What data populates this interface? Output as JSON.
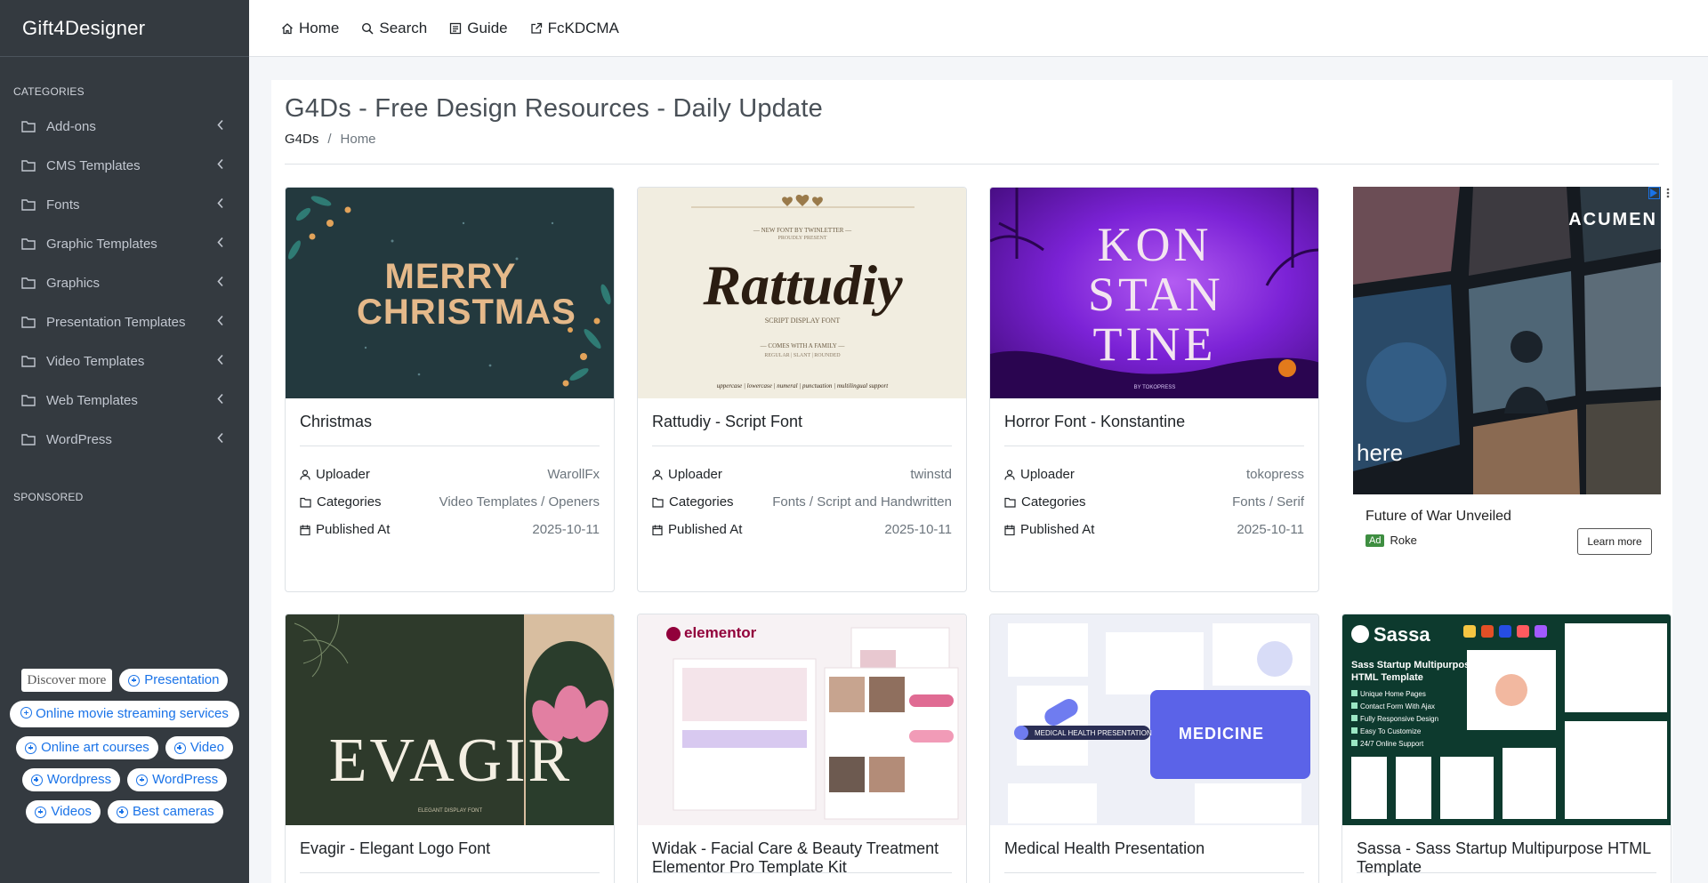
{
  "sidebar": {
    "brand": "Gift4Designer",
    "categories_header": "CATEGORIES",
    "items": [
      {
        "label": "Add-ons"
      },
      {
        "label": "CMS Templates"
      },
      {
        "label": "Fonts"
      },
      {
        "label": "Graphic Templates"
      },
      {
        "label": "Graphics"
      },
      {
        "label": "Presentation Templates"
      },
      {
        "label": "Video Templates"
      },
      {
        "label": "Web Templates"
      },
      {
        "label": "WordPress"
      }
    ],
    "sponsored_header": "SPONSORED",
    "chips": {
      "discover": "Discover more",
      "presentation": "Presentation",
      "streaming": "Online movie streaming services",
      "art": "Online art courses",
      "video": "Video",
      "wordpress1": "Wordpress",
      "wordpress2": "WordPress",
      "videos": "Videos",
      "cameras": "Best cameras"
    }
  },
  "topnav": {
    "home": "Home",
    "search": "Search",
    "guide": "Guide",
    "fckdcma": "FcKDCMA"
  },
  "page": {
    "title": "G4Ds - Free Design Resources - Daily Update",
    "breadcrumb": {
      "root": "G4Ds",
      "current": "Home"
    }
  },
  "meta_labels": {
    "uploader": "Uploader",
    "categories": "Categories",
    "published": "Published At"
  },
  "cards": [
    {
      "title": "Christmas",
      "uploader": "WarollFx",
      "categories": "Video Templates / Openers",
      "published": "2025-10-11",
      "thumb_text": "MERRY CHRISTMAS"
    },
    {
      "title": "Rattudiy - Script Font",
      "uploader": "twinstd",
      "categories": "Fonts / Script and Handwritten",
      "published": "2025-10-11",
      "thumb_text": "Rattudiy"
    },
    {
      "title": "Horror Font - Konstantine",
      "uploader": "tokopress",
      "categories": "Fonts / Serif",
      "published": "2025-10-11",
      "thumb_text": "KON STAN TINE"
    },
    {
      "title": "Evagir - Elegant Logo Font",
      "thumb_text": "EVAGIR"
    },
    {
      "title": "Widak - Facial Care & Beauty Treatment Elementor Pro Template Kit",
      "thumb_text": "elementor"
    },
    {
      "title": "Medical Health Presentation",
      "thumb_text": "MEDICINE"
    },
    {
      "title": "Sassa - Sass Startup Multipurpose HTML Template",
      "thumb_text": "Sassa"
    }
  ],
  "ad": {
    "brand_text": "ACUMEN",
    "title": "Future of War Unveiled",
    "badge": "Ad",
    "source": "Roke",
    "button": "Learn more",
    "overlay_text": "here"
  }
}
